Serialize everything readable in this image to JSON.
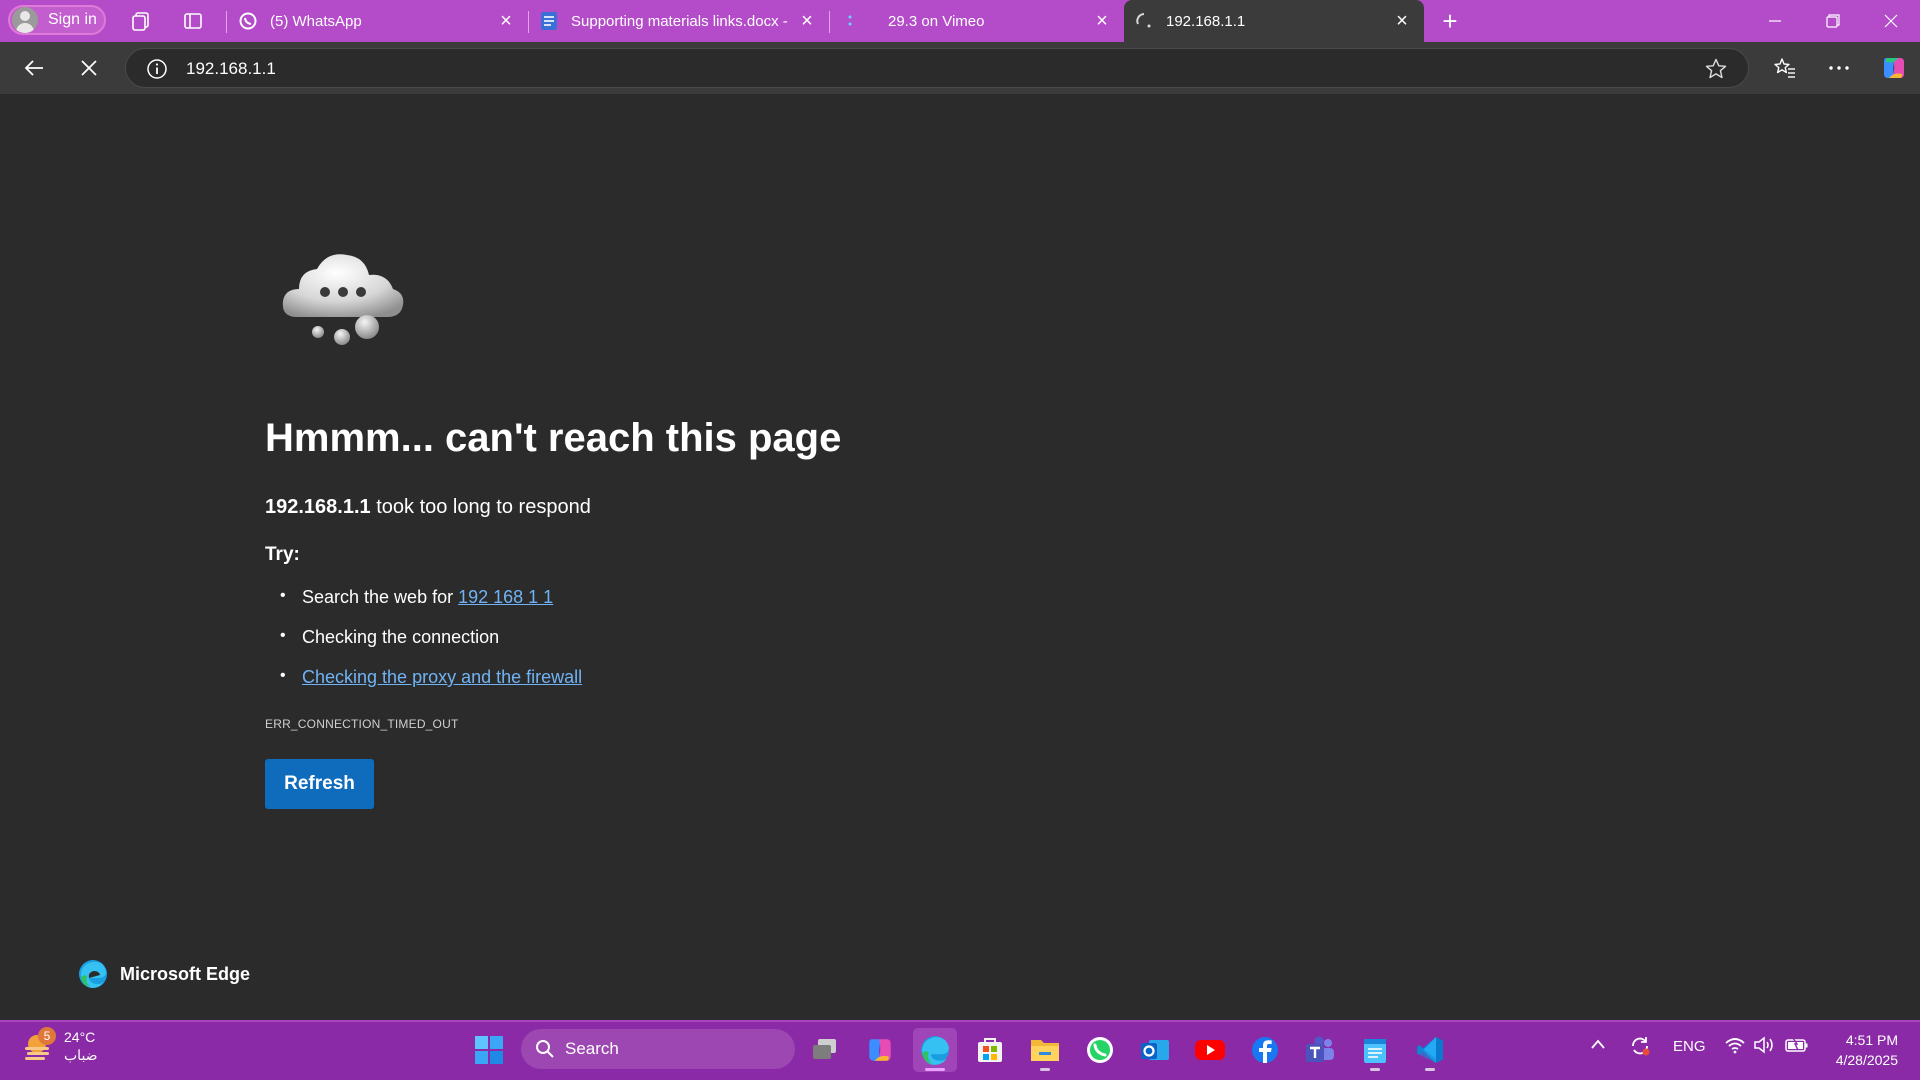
{
  "browser": {
    "signin_label": "Sign in",
    "tabs": [
      {
        "title": "(5) WhatsApp",
        "icon": "whatsapp-icon"
      },
      {
        "title": "Supporting materials links.docx -",
        "icon": "word-doc-icon"
      },
      {
        "title": "29.3 on Vimeo",
        "icon": "vimeo-icon"
      },
      {
        "title": "192.168.1.1",
        "icon": "loading-icon",
        "active": true
      }
    ],
    "address": "192.168.1.1"
  },
  "error_page": {
    "heading": "Hmmm... can't reach this page",
    "host": "192.168.1.1",
    "host_suffix": " took too long to respond",
    "try_label": "Try:",
    "suggestion_search_prefix": "Search the web for ",
    "suggestion_search_link": "192 168 1 1",
    "suggestion_connection": "Checking the connection",
    "suggestion_proxy": "Checking the proxy and the firewall",
    "error_code": "ERR_CONNECTION_TIMED_OUT",
    "refresh_label": "Refresh",
    "brand": "Microsoft Edge"
  },
  "taskbar": {
    "weather_temp": "24°C",
    "weather_desc": "ضباب",
    "weather_badge": "5",
    "search_label": "Search",
    "apps": [
      "task-view",
      "copilot",
      "edge",
      "store",
      "file-explorer",
      "whatsapp",
      "outlook",
      "youtube",
      "facebook",
      "teams",
      "notepad",
      "vscode"
    ],
    "language": "ENG",
    "time": "4:51 PM",
    "date": "4/28/2025"
  },
  "colors": {
    "tabstrip": "#b44bc9",
    "taskbar": "#8b2aa6",
    "page_bg": "#2b2b2b",
    "link": "#70b3f5",
    "button": "#0f6cbd"
  }
}
